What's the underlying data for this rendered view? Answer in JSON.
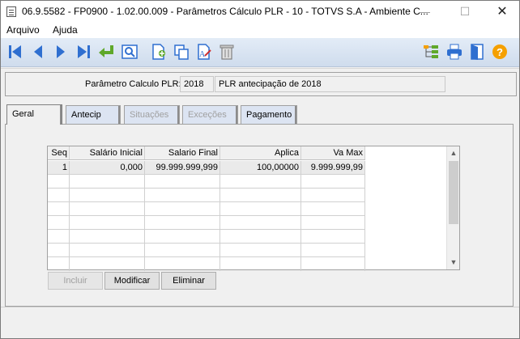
{
  "window": {
    "title": "06.9.5582 - FP0900 - 1.02.00.009 - Parâmetros Cálculo PLR - 10 - TOTVS S.A - Ambiente C...",
    "minimize": "—",
    "maximize": "☐",
    "close": "✕"
  },
  "menu": {
    "items": [
      "Arquivo",
      "Ajuda"
    ]
  },
  "toolbar": {
    "icons": [
      "first-record-icon",
      "previous-record-icon",
      "next-record-icon",
      "last-record-icon",
      "go-to-icon",
      "search-icon",
      "new-record-icon",
      "copy-record-icon",
      "edit-record-icon",
      "delete-record-icon",
      "tree-icon",
      "print-icon",
      "exit-icon",
      "help-icon"
    ]
  },
  "header": {
    "param_label": "Parâmetro Calculo PLR:",
    "year": "2018",
    "description": "PLR antecipação de 2018"
  },
  "tabs": [
    {
      "label": "Geral",
      "state": "active"
    },
    {
      "label": "Antecip",
      "state": "enabled"
    },
    {
      "label": "Situações",
      "state": "disabled"
    },
    {
      "label": "Exceções",
      "state": "disabled"
    },
    {
      "label": "Pagamento",
      "state": "enabled"
    }
  ],
  "grid": {
    "columns": [
      "Seq",
      "Salário Inicial",
      "Salario Final",
      "Aplica",
      "Va Max"
    ],
    "rows": [
      [
        "1",
        "0,000",
        "99.999.999,999",
        "100,00000",
        "9.999.999,99"
      ]
    ],
    "scroll_up": "▲",
    "scroll_down": "▼"
  },
  "buttons": {
    "incluir": "Incluir",
    "modificar": "Modificar",
    "eliminar": "Eliminar"
  },
  "colors": {
    "toolbar_blue": "#2f6fd0",
    "toolbar_green": "#5fa82a",
    "help_orange": "#f5a000"
  }
}
